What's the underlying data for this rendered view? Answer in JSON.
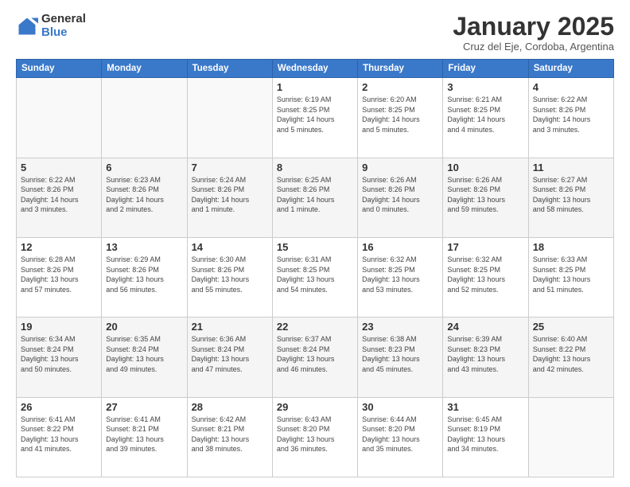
{
  "header": {
    "logo_general": "General",
    "logo_blue": "Blue",
    "month_title": "January 2025",
    "location": "Cruz del Eje, Cordoba, Argentina"
  },
  "days_of_week": [
    "Sunday",
    "Monday",
    "Tuesday",
    "Wednesday",
    "Thursday",
    "Friday",
    "Saturday"
  ],
  "weeks": [
    [
      {
        "day": "",
        "info": ""
      },
      {
        "day": "",
        "info": ""
      },
      {
        "day": "",
        "info": ""
      },
      {
        "day": "1",
        "info": "Sunrise: 6:19 AM\nSunset: 8:25 PM\nDaylight: 14 hours\nand 5 minutes."
      },
      {
        "day": "2",
        "info": "Sunrise: 6:20 AM\nSunset: 8:25 PM\nDaylight: 14 hours\nand 5 minutes."
      },
      {
        "day": "3",
        "info": "Sunrise: 6:21 AM\nSunset: 8:25 PM\nDaylight: 14 hours\nand 4 minutes."
      },
      {
        "day": "4",
        "info": "Sunrise: 6:22 AM\nSunset: 8:26 PM\nDaylight: 14 hours\nand 3 minutes."
      }
    ],
    [
      {
        "day": "5",
        "info": "Sunrise: 6:22 AM\nSunset: 8:26 PM\nDaylight: 14 hours\nand 3 minutes."
      },
      {
        "day": "6",
        "info": "Sunrise: 6:23 AM\nSunset: 8:26 PM\nDaylight: 14 hours\nand 2 minutes."
      },
      {
        "day": "7",
        "info": "Sunrise: 6:24 AM\nSunset: 8:26 PM\nDaylight: 14 hours\nand 1 minute."
      },
      {
        "day": "8",
        "info": "Sunrise: 6:25 AM\nSunset: 8:26 PM\nDaylight: 14 hours\nand 1 minute."
      },
      {
        "day": "9",
        "info": "Sunrise: 6:26 AM\nSunset: 8:26 PM\nDaylight: 14 hours\nand 0 minutes."
      },
      {
        "day": "10",
        "info": "Sunrise: 6:26 AM\nSunset: 8:26 PM\nDaylight: 13 hours\nand 59 minutes."
      },
      {
        "day": "11",
        "info": "Sunrise: 6:27 AM\nSunset: 8:26 PM\nDaylight: 13 hours\nand 58 minutes."
      }
    ],
    [
      {
        "day": "12",
        "info": "Sunrise: 6:28 AM\nSunset: 8:26 PM\nDaylight: 13 hours\nand 57 minutes."
      },
      {
        "day": "13",
        "info": "Sunrise: 6:29 AM\nSunset: 8:26 PM\nDaylight: 13 hours\nand 56 minutes."
      },
      {
        "day": "14",
        "info": "Sunrise: 6:30 AM\nSunset: 8:26 PM\nDaylight: 13 hours\nand 55 minutes."
      },
      {
        "day": "15",
        "info": "Sunrise: 6:31 AM\nSunset: 8:25 PM\nDaylight: 13 hours\nand 54 minutes."
      },
      {
        "day": "16",
        "info": "Sunrise: 6:32 AM\nSunset: 8:25 PM\nDaylight: 13 hours\nand 53 minutes."
      },
      {
        "day": "17",
        "info": "Sunrise: 6:32 AM\nSunset: 8:25 PM\nDaylight: 13 hours\nand 52 minutes."
      },
      {
        "day": "18",
        "info": "Sunrise: 6:33 AM\nSunset: 8:25 PM\nDaylight: 13 hours\nand 51 minutes."
      }
    ],
    [
      {
        "day": "19",
        "info": "Sunrise: 6:34 AM\nSunset: 8:24 PM\nDaylight: 13 hours\nand 50 minutes."
      },
      {
        "day": "20",
        "info": "Sunrise: 6:35 AM\nSunset: 8:24 PM\nDaylight: 13 hours\nand 49 minutes."
      },
      {
        "day": "21",
        "info": "Sunrise: 6:36 AM\nSunset: 8:24 PM\nDaylight: 13 hours\nand 47 minutes."
      },
      {
        "day": "22",
        "info": "Sunrise: 6:37 AM\nSunset: 8:24 PM\nDaylight: 13 hours\nand 46 minutes."
      },
      {
        "day": "23",
        "info": "Sunrise: 6:38 AM\nSunset: 8:23 PM\nDaylight: 13 hours\nand 45 minutes."
      },
      {
        "day": "24",
        "info": "Sunrise: 6:39 AM\nSunset: 8:23 PM\nDaylight: 13 hours\nand 43 minutes."
      },
      {
        "day": "25",
        "info": "Sunrise: 6:40 AM\nSunset: 8:22 PM\nDaylight: 13 hours\nand 42 minutes."
      }
    ],
    [
      {
        "day": "26",
        "info": "Sunrise: 6:41 AM\nSunset: 8:22 PM\nDaylight: 13 hours\nand 41 minutes."
      },
      {
        "day": "27",
        "info": "Sunrise: 6:41 AM\nSunset: 8:21 PM\nDaylight: 13 hours\nand 39 minutes."
      },
      {
        "day": "28",
        "info": "Sunrise: 6:42 AM\nSunset: 8:21 PM\nDaylight: 13 hours\nand 38 minutes."
      },
      {
        "day": "29",
        "info": "Sunrise: 6:43 AM\nSunset: 8:20 PM\nDaylight: 13 hours\nand 36 minutes."
      },
      {
        "day": "30",
        "info": "Sunrise: 6:44 AM\nSunset: 8:20 PM\nDaylight: 13 hours\nand 35 minutes."
      },
      {
        "day": "31",
        "info": "Sunrise: 6:45 AM\nSunset: 8:19 PM\nDaylight: 13 hours\nand 34 minutes."
      },
      {
        "day": "",
        "info": ""
      }
    ]
  ]
}
